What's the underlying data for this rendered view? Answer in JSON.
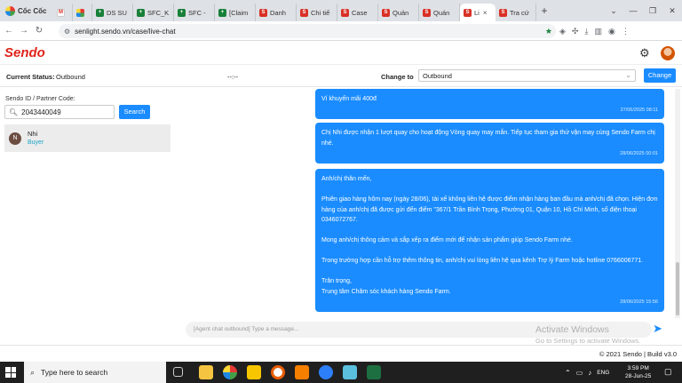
{
  "browser": {
    "brand": "Cốc Cốc",
    "tabs": [
      {
        "label": "",
        "icon": "gmail-icon"
      },
      {
        "label": "",
        "icon": "apps-icon"
      },
      {
        "label": "DS SU",
        "icon": "sheets-icon"
      },
      {
        "label": "SFC_K",
        "icon": "sheets-icon"
      },
      {
        "label": "SFC - ",
        "icon": "sheets-icon"
      },
      {
        "label": "[Claim",
        "icon": "sheets-icon"
      },
      {
        "label": "Danh",
        "icon": "sendo-icon"
      },
      {
        "label": "Chi tiế",
        "icon": "sendo-icon"
      },
      {
        "label": "Case",
        "icon": "sendo-icon"
      },
      {
        "label": "Quản",
        "icon": "sendo-icon"
      },
      {
        "label": "Quản",
        "icon": "sendo-icon"
      },
      {
        "label": "Li",
        "icon": "sendo-icon",
        "active": true
      },
      {
        "label": "Tra cứ",
        "icon": "sendo-icon"
      }
    ],
    "url": "senlight.sendo.vn/case/live-chat"
  },
  "app": {
    "logo": "Sendo",
    "status_label": "Current Status:",
    "status_value": "Outbound",
    "timer": "--:--",
    "change_to_label": "Change to",
    "change_to_value": "Outbound",
    "change_button": "Change"
  },
  "sidebar": {
    "id_label": "Sendo ID / Partner Code:",
    "id_value": "2043440049",
    "search_button": "Search",
    "contact": {
      "initial": "N",
      "name": "Nhi",
      "role": "Buyer"
    }
  },
  "chat": {
    "messages": [
      {
        "lines": [
          "Ví khuyến mãi 400đ"
        ],
        "time": "27/06/2025 08:11"
      },
      {
        "lines": [
          "Chị Nhi  được nhận 1 lượt quay cho hoạt động Vòng quay may mắn. Tiếp tục tham gia thử vận may cùng Sendo Farm chị nhé."
        ],
        "time": "28/06/2025 00:01"
      },
      {
        "lines": [
          "Anh/chị thân mến,",
          "",
          "Phiên giao hàng hôm nay (ngày 28/06), tài xế không liên hệ được điểm nhận hàng ban đầu mà anh/chị đã chọn. Hiện đơn hàng của anh/chị đã được gửi đến điểm \"367/1 Trần Bình Trọng, Phường 01, Quận 10, Hồ Chí Minh, số điện thoại 0346072767.",
          "",
          "Mong anh/chị thông cảm và sắp xếp ra điểm mới để nhận sản phẩm giúp Sendo Farm nhé.",
          "",
          "Trong trường hợp cần hỗ trợ thêm thông tin, anh/chị vui lòng liên hệ qua kênh Trợ lý Farm hoặc hotline 0766006771.",
          "",
          "Trân trọng,",
          "Trung tâm Chăm sóc khách hàng Sendo Farm."
        ],
        "time": "28/06/2025 15:56"
      }
    ],
    "input_placeholder": "[Agent chat outbound] Type a message...",
    "watermark_title": "Activate Windows",
    "watermark_sub": "Go to Settings to activate Windows."
  },
  "footer": "© 2021 Sendo | Build v3.0",
  "taskbar": {
    "search_placeholder": "Type here to search",
    "time": "3:59 PM",
    "date": "28-Jun-25",
    "lang": "ENG"
  }
}
